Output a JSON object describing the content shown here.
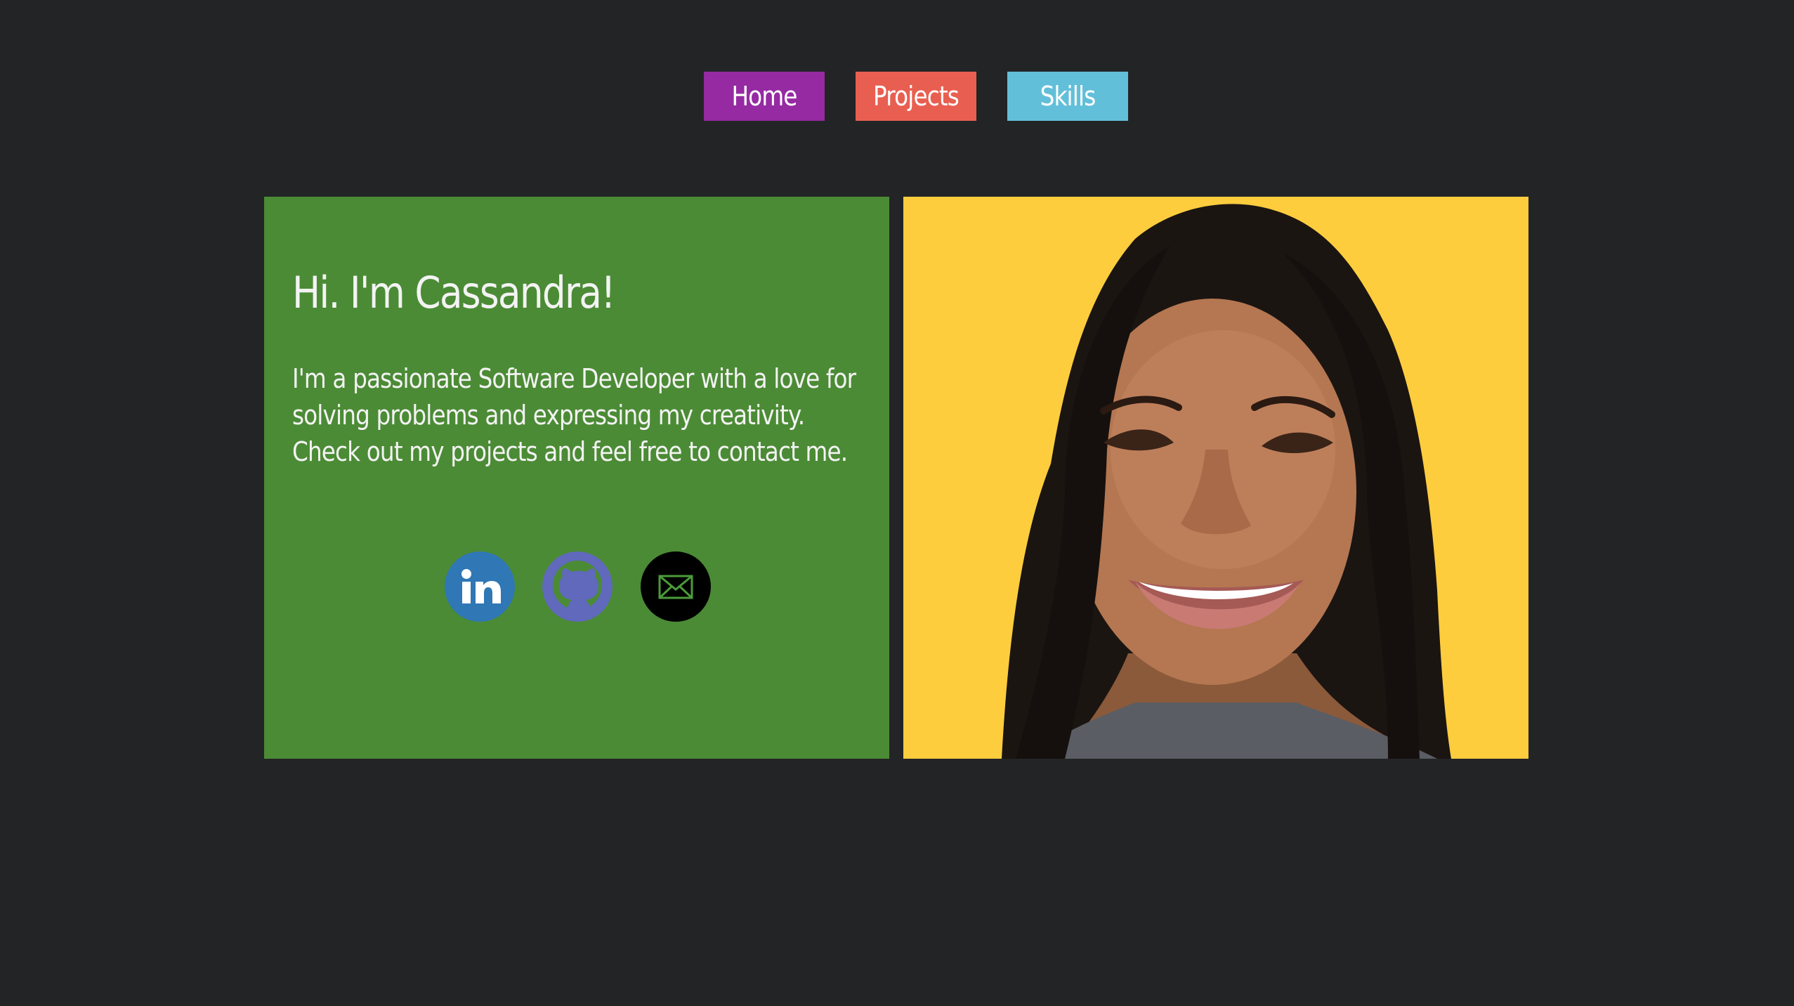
{
  "nav": {
    "items": [
      {
        "label": "Home",
        "color": "#962aa3"
      },
      {
        "label": "Projects",
        "color": "#e85f51"
      },
      {
        "label": "Skills",
        "color": "#62bfd9"
      }
    ]
  },
  "intro": {
    "heading": "Hi. I'm Cassandra!",
    "body": "I'm a passionate Software Developer with a love for solving problems and expressing my creativity. Check out my projects and feel free to contact me.",
    "card_color": "#4b8b35"
  },
  "socials": [
    {
      "name": "linkedin-icon",
      "color": "#2f77b5"
    },
    {
      "name": "github-icon",
      "color": "#6069bb"
    },
    {
      "name": "email-icon",
      "color": "#000000"
    }
  ],
  "photo": {
    "background_color": "#fdcd3e"
  },
  "colors": {
    "page_background": "#232426",
    "text": "#f3f3f3"
  }
}
